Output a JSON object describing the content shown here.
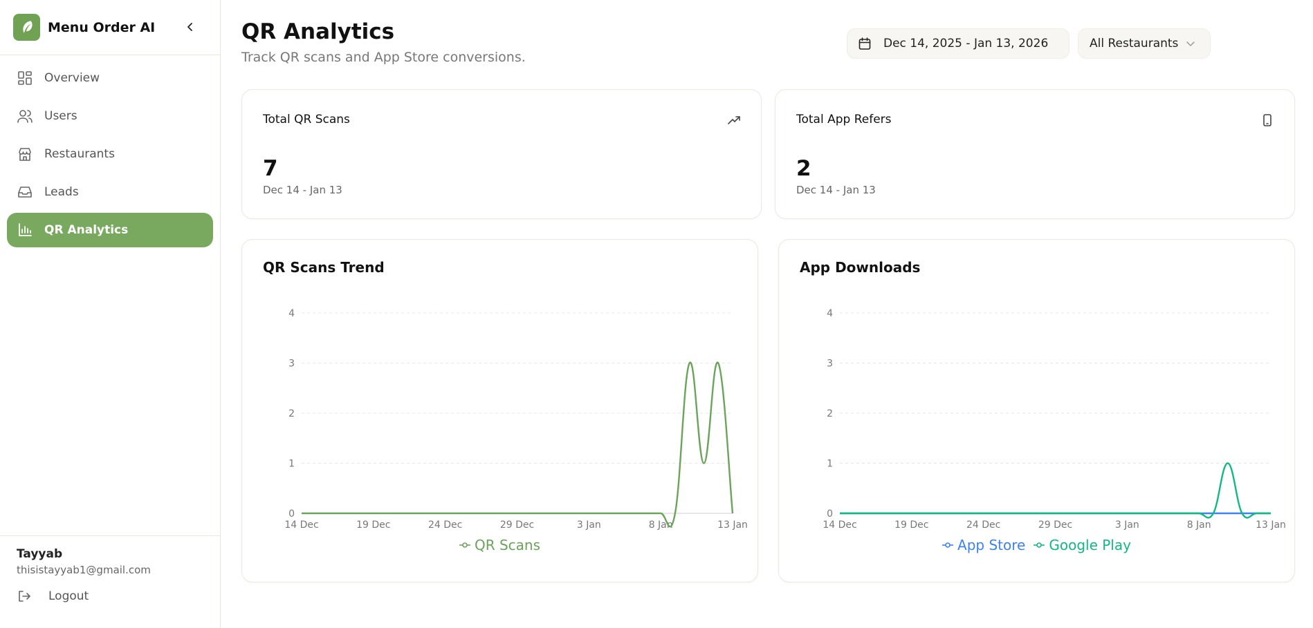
{
  "app": {
    "name": "Menu Order AI"
  },
  "sidebar": {
    "items": [
      {
        "label": "Overview",
        "icon": "grid-icon"
      },
      {
        "label": "Users",
        "icon": "users-icon"
      },
      {
        "label": "Restaurants",
        "icon": "store-icon"
      },
      {
        "label": "Leads",
        "icon": "inbox-icon"
      },
      {
        "label": "QR Analytics",
        "icon": "bar-chart-icon",
        "active": true
      }
    ]
  },
  "user": {
    "name": "Tayyab",
    "email": "thisistayyab1@gmail.com",
    "logout_label": "Logout"
  },
  "header": {
    "title": "QR Analytics",
    "subtitle": "Track QR scans and App Store conversions.",
    "date_range": "Dec 14, 2025 - Jan 13, 2026",
    "restaurant_filter": "All Restaurants"
  },
  "stats": [
    {
      "label": "Total QR Scans",
      "value": "7",
      "period": "Dec 14 - Jan 13",
      "icon": "trending-up-icon"
    },
    {
      "label": "Total App Refers",
      "value": "2",
      "period": "Dec 14 - Jan 13",
      "icon": "smartphone-icon"
    }
  ],
  "colors": {
    "accent": "#79a95f",
    "qr_line": "#6aa35a",
    "app_store": "#3b82f6",
    "google_play": "#10b981"
  },
  "chart_data": [
    {
      "type": "line",
      "title": "QR Scans Trend",
      "x": [
        "14 Dec",
        "15 Dec",
        "16 Dec",
        "17 Dec",
        "18 Dec",
        "19 Dec",
        "20 Dec",
        "21 Dec",
        "22 Dec",
        "23 Dec",
        "24 Dec",
        "25 Dec",
        "26 Dec",
        "27 Dec",
        "28 Dec",
        "29 Dec",
        "30 Dec",
        "31 Dec",
        "1 Jan",
        "2 Jan",
        "3 Jan",
        "4 Jan",
        "5 Jan",
        "6 Jan",
        "7 Jan",
        "8 Jan",
        "9 Jan",
        "10 Jan",
        "11 Jan",
        "12 Jan",
        "13 Jan"
      ],
      "tick_labels": [
        "14 Dec",
        "19 Dec",
        "24 Dec",
        "29 Dec",
        "3 Jan",
        "8 Jan",
        "13 Jan"
      ],
      "ylim": [
        0,
        4
      ],
      "yticks": [
        0,
        1,
        2,
        3,
        4
      ],
      "series": [
        {
          "name": "QR Scans",
          "color": "#6aa35a",
          "values": [
            0,
            0,
            0,
            0,
            0,
            0,
            0,
            0,
            0,
            0,
            0,
            0,
            0,
            0,
            0,
            0,
            0,
            0,
            0,
            0,
            0,
            0,
            0,
            0,
            0,
            0,
            0,
            3,
            1,
            3,
            0
          ]
        }
      ],
      "grid": true,
      "legend": "bottom"
    },
    {
      "type": "line",
      "title": "App Downloads",
      "x": [
        "14 Dec",
        "15 Dec",
        "16 Dec",
        "17 Dec",
        "18 Dec",
        "19 Dec",
        "20 Dec",
        "21 Dec",
        "22 Dec",
        "23 Dec",
        "24 Dec",
        "25 Dec",
        "26 Dec",
        "27 Dec",
        "28 Dec",
        "29 Dec",
        "30 Dec",
        "31 Dec",
        "1 Jan",
        "2 Jan",
        "3 Jan",
        "4 Jan",
        "5 Jan",
        "6 Jan",
        "7 Jan",
        "8 Jan",
        "9 Jan",
        "10 Jan",
        "11 Jan",
        "12 Jan",
        "13 Jan"
      ],
      "tick_labels": [
        "14 Dec",
        "19 Dec",
        "24 Dec",
        "29 Dec",
        "3 Jan",
        "8 Jan",
        "13 Jan"
      ],
      "ylim": [
        0,
        4
      ],
      "yticks": [
        0,
        1,
        2,
        3,
        4
      ],
      "series": [
        {
          "name": "App Store",
          "color": "#3b82f6",
          "values": [
            0,
            0,
            0,
            0,
            0,
            0,
            0,
            0,
            0,
            0,
            0,
            0,
            0,
            0,
            0,
            0,
            0,
            0,
            0,
            0,
            0,
            0,
            0,
            0,
            0,
            0,
            0,
            0,
            0,
            0,
            0
          ]
        },
        {
          "name": "Google Play",
          "color": "#10b981",
          "values": [
            0,
            0,
            0,
            0,
            0,
            0,
            0,
            0,
            0,
            0,
            0,
            0,
            0,
            0,
            0,
            0,
            0,
            0,
            0,
            0,
            0,
            0,
            0,
            0,
            0,
            0,
            0,
            1,
            0,
            0,
            0
          ]
        }
      ],
      "grid": true,
      "legend": "bottom"
    }
  ]
}
